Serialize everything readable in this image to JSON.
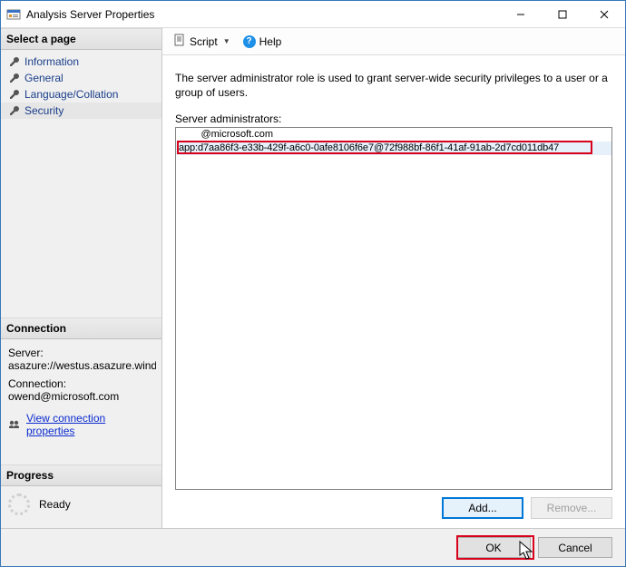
{
  "window": {
    "title": "Analysis Server Properties"
  },
  "sidebar": {
    "select_page": "Select a page",
    "items": [
      {
        "label": "Information"
      },
      {
        "label": "General"
      },
      {
        "label": "Language/Collation"
      },
      {
        "label": "Security"
      }
    ],
    "connection_header": "Connection",
    "server_label": "Server:",
    "server_value": "asazure://westus.asazure.windows",
    "connection_label": "Connection:",
    "connection_value": "owend@microsoft.com",
    "view_conn_props": "View connection properties",
    "progress_header": "Progress",
    "progress_status": "Ready"
  },
  "toolbar": {
    "script": "Script",
    "help": "Help"
  },
  "main": {
    "description": "The server administrator role is used to grant server-wide security privileges to a user or a group of users.",
    "list_label": "Server administrators:",
    "admins": [
      "        @microsoft.com",
      "app:d7aa86f3-e33b-429f-a6c0-0afe8106f6e7@72f988bf-86f1-41af-91ab-2d7cd011db47"
    ],
    "add": "Add...",
    "remove": "Remove..."
  },
  "footer": {
    "ok": "OK",
    "cancel": "Cancel"
  }
}
